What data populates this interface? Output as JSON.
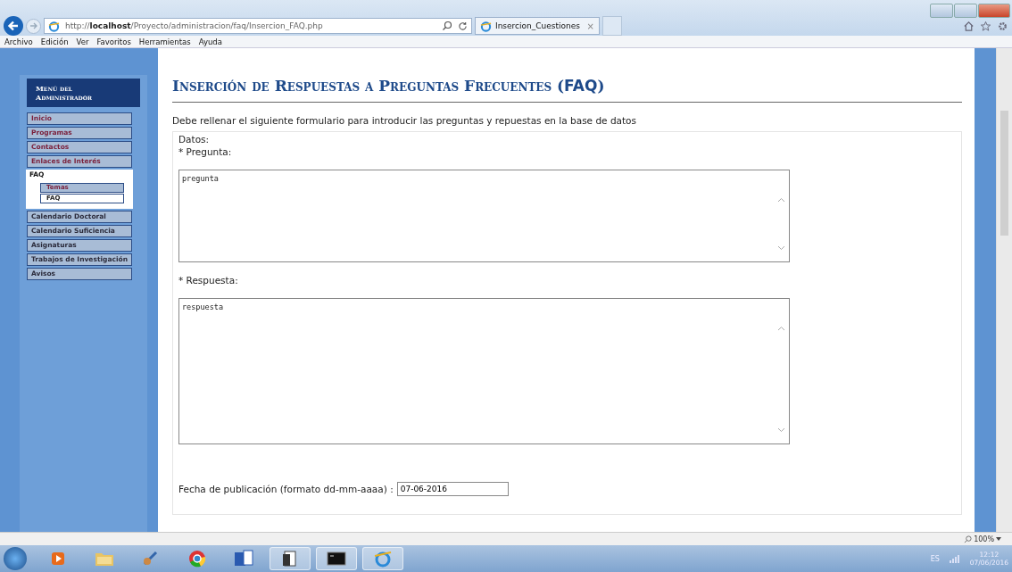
{
  "browser": {
    "url_prefix": "http://",
    "url_host": "localhost",
    "url_path": "/Proyecto/administracion/faq/Insercion_FAQ.php",
    "tab_title": "Insercion_Cuestiones",
    "close_glyph": "×"
  },
  "menubar": [
    "Archivo",
    "Edición",
    "Ver",
    "Favoritos",
    "Herramientas",
    "Ayuda"
  ],
  "sidebar": {
    "title_line1": "Menú del",
    "title_line2": "Administrador",
    "items": [
      {
        "label": "Inicio",
        "visited": true,
        "selected": false,
        "expanded": false
      },
      {
        "label": "Programas",
        "visited": true,
        "selected": false,
        "expanded": false
      },
      {
        "label": "Contactos",
        "visited": true,
        "selected": false,
        "expanded": false
      },
      {
        "label": "Enlaces de Interés",
        "visited": true,
        "selected": false,
        "expanded": false
      },
      {
        "label": "FAQ",
        "visited": false,
        "selected": true,
        "expanded": true,
        "children": [
          {
            "label": "Temas",
            "visited": true,
            "selected": false
          },
          {
            "label": "FAQ",
            "visited": false,
            "selected": true
          }
        ]
      },
      {
        "label": "Calendario Doctoral",
        "visited": false,
        "selected": false,
        "expanded": false
      },
      {
        "label": "Calendario Suficiencia",
        "visited": false,
        "selected": false,
        "expanded": false
      },
      {
        "label": "Asignaturas",
        "visited": false,
        "selected": false,
        "expanded": false
      },
      {
        "label": "Trabajos de Investigación",
        "visited": false,
        "selected": false,
        "expanded": false
      },
      {
        "label": "Avisos",
        "visited": false,
        "selected": false,
        "expanded": false
      }
    ]
  },
  "page": {
    "title": "Inserción de Respuestas a Preguntas Frecuentes (**FAQ**)",
    "intro": "Debe rellenar el siguiente formulario para introducir las preguntas y repuestas en la base de datos",
    "legend": "Datos:",
    "fields": [
      {
        "label": "* Pregunta:",
        "value": "pregunta",
        "kind": "short"
      },
      {
        "label": "* Respuesta:",
        "value": "respuesta",
        "kind": "long"
      }
    ],
    "date_label": "Fecha de publicación (formato dd-mm-aaaa) :",
    "date_value": "07-06-2016"
  },
  "status_bar": {
    "zoom": "100%"
  },
  "taskbar": {
    "language": "ES",
    "time": "12:12",
    "date": "07/06/2016"
  }
}
